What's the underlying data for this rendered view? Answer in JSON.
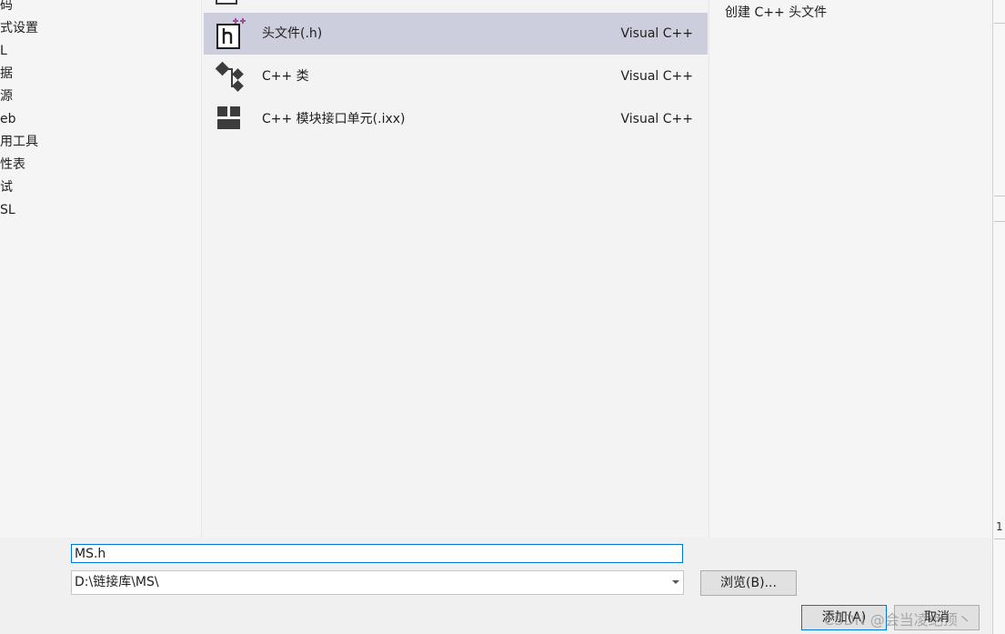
{
  "categories": [
    "码",
    "式设置",
    "L",
    "据",
    "源",
    "eb",
    "用工具",
    "性表",
    "试",
    "SL"
  ],
  "templates": [
    {
      "name": "头文件(.h)",
      "language": "Visual C++",
      "icon": "header-file-icon",
      "selected": true
    },
    {
      "name": "C++ 类",
      "language": "Visual C++",
      "icon": "cpp-class-icon",
      "selected": false
    },
    {
      "name": "C++ 模块接口单元(.ixx)",
      "language": "Visual C++",
      "icon": "module-interface-icon",
      "selected": false
    }
  ],
  "description": "创建 C++ 头文件",
  "form": {
    "name_value": "MS.h",
    "location_value": "D:\\链接库\\MS\\"
  },
  "buttons": {
    "browse": "浏览(B)...",
    "add": "添加(A)",
    "cancel": "取消"
  },
  "watermark": "CSDN @会当凌绝顶丶",
  "edge_text": "1",
  "colors": {
    "selection": "#cdcedd",
    "focus_border": "#0078d7",
    "icon_accent": "#9b4f96"
  }
}
